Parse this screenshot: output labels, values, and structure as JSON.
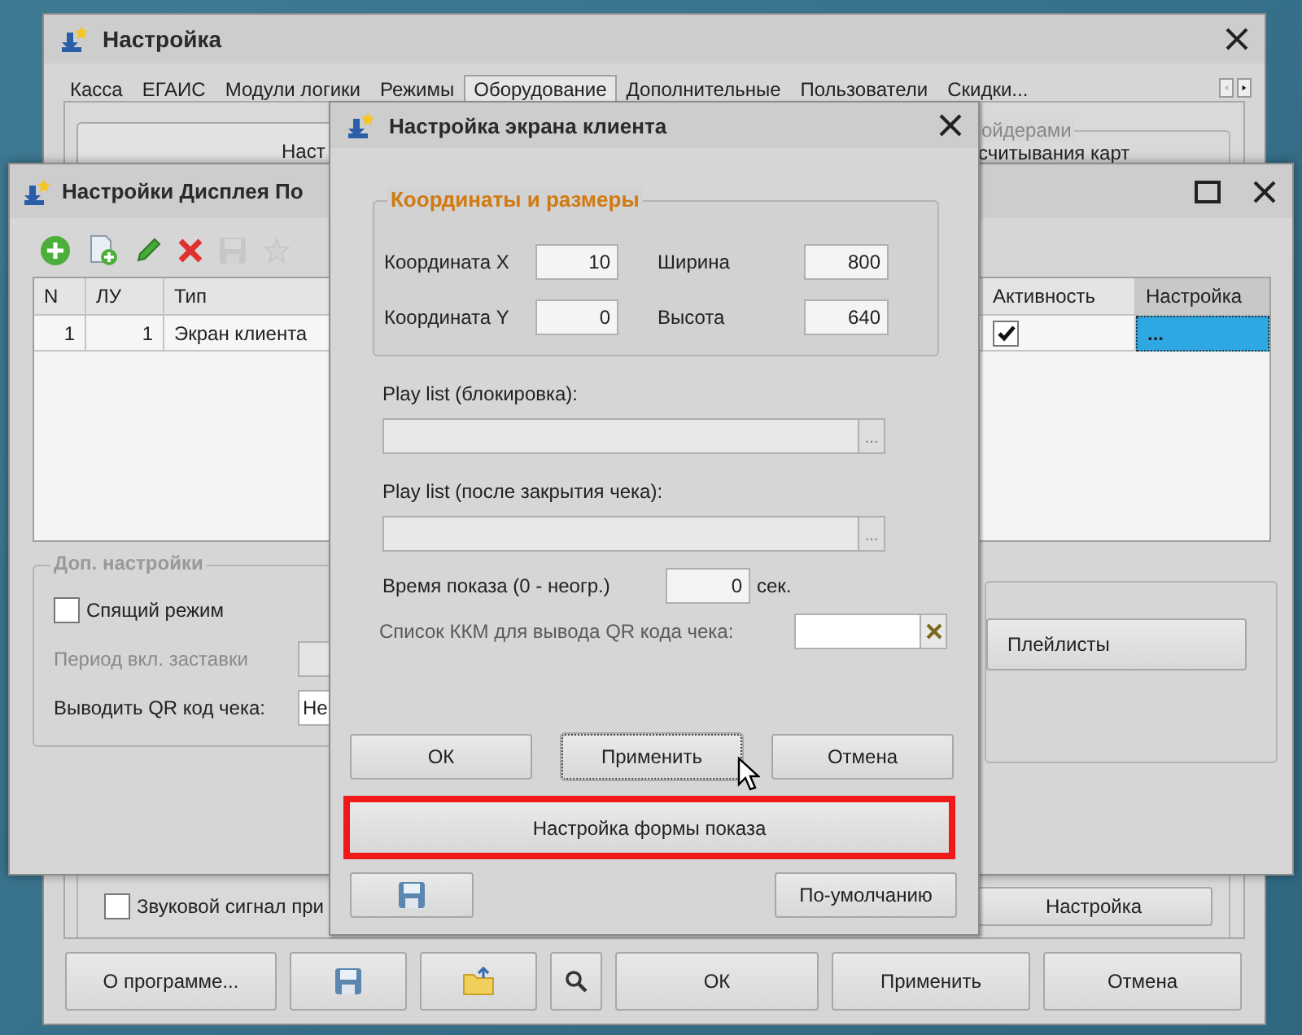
{
  "main_window": {
    "title": "Настройка",
    "tabs": [
      {
        "label": "Касса",
        "selected": false
      },
      {
        "label": "ЕГАИС",
        "selected": false
      },
      {
        "label": "Модули логики",
        "selected": false
      },
      {
        "label": "Режимы",
        "selected": false
      },
      {
        "label": "Оборудование",
        "selected": true
      },
      {
        "label": "Дополнительные",
        "selected": false
      },
      {
        "label": "Пользователи",
        "selected": false
      },
      {
        "label": "Скидки...",
        "selected": false
      }
    ],
    "panel_button": "Наст",
    "group": {
      "title": "ойдерами",
      "text": "считывания карт"
    },
    "sound_checkbox": {
      "label": "Звуковой сигнал при",
      "checked": false
    },
    "setup_button": "Настройка",
    "buttons": [
      {
        "kind": "text",
        "label": "О программе..."
      },
      {
        "kind": "save"
      },
      {
        "kind": "folder"
      },
      {
        "kind": "search"
      },
      {
        "kind": "text",
        "label": "ОК"
      },
      {
        "kind": "text",
        "label": "Применить"
      },
      {
        "kind": "text",
        "label": "Отмена"
      }
    ]
  },
  "display_window": {
    "title": "Настройки Дисплея По",
    "toolbar": [
      {
        "kind": "add",
        "disabled": false
      },
      {
        "kind": "copy",
        "disabled": false
      },
      {
        "kind": "edit",
        "disabled": false
      },
      {
        "kind": "delete",
        "disabled": false
      },
      {
        "kind": "save",
        "disabled": true
      },
      {
        "kind": "up",
        "disabled": true
      }
    ],
    "table": {
      "columns": [
        "N",
        "ЛУ",
        "Тип",
        "Активность",
        "Настройка"
      ],
      "rows": [
        {
          "n": "1",
          "lu": "1",
          "type": "Экран клиента",
          "active": true,
          "setting": "...",
          "selected": true
        }
      ]
    },
    "extra": {
      "title": "Доп. настройки",
      "sleep": {
        "label": "Спящий режим",
        "checked": false
      },
      "splash": {
        "label": "Период вкл. заставки",
        "disabled": true
      },
      "qr": {
        "label": "Выводить QR код чека:",
        "value": "Не"
      }
    },
    "playlists_button": "Плейлисты"
  },
  "dialog": {
    "title": "Настройка экрана клиента",
    "coords": {
      "title": "Координаты и размеры",
      "fields": [
        {
          "label": "Координата X",
          "value": "10"
        },
        {
          "label": "Ширина",
          "value": "800"
        },
        {
          "label": "Координата Y",
          "value": "0"
        },
        {
          "label": "Высота",
          "value": "640"
        }
      ]
    },
    "playlists": [
      {
        "label": "Play list (блокировка):",
        "button": "..."
      },
      {
        "label": "Play list (после закрытия чека):",
        "button": "..."
      }
    ],
    "time": {
      "label": "Время показа (0 - неогр.)",
      "value": "0",
      "unit": "сек."
    },
    "kkm": {
      "label": "Список ККМ для вывода QR кода чека:"
    },
    "buttons": [
      {
        "label": "ОК",
        "focused": false
      },
      {
        "label": "Применить",
        "focused": true
      },
      {
        "label": "Отмена",
        "focused": false
      }
    ],
    "form_button": {
      "label": "Настройка формы показа",
      "highlighted": true
    },
    "default_button": "По-умолчанию"
  }
}
